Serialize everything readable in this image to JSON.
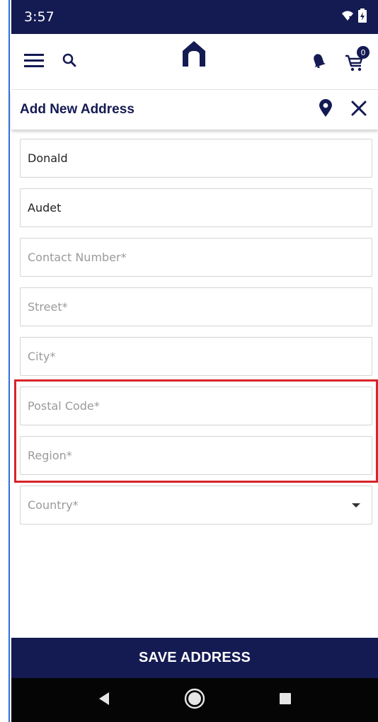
{
  "status_bar": {
    "time": "3:57"
  },
  "top_nav": {
    "cart_count": "0"
  },
  "header": {
    "title": "Add New Address"
  },
  "form": {
    "first_name": {
      "value": "Donald",
      "placeholder": ""
    },
    "last_name": {
      "value": "Audet",
      "placeholder": ""
    },
    "contact_number": {
      "value": "",
      "placeholder": "Contact Number*"
    },
    "street": {
      "value": "",
      "placeholder": "Street*"
    },
    "city": {
      "value": "",
      "placeholder": "City*"
    },
    "postal_code": {
      "value": "",
      "placeholder": "Postal Code*"
    },
    "region": {
      "value": "",
      "placeholder": "Region*"
    },
    "country": {
      "value": "",
      "placeholder": "Country*"
    }
  },
  "footer": {
    "save_label": "SAVE ADDRESS"
  },
  "colors": {
    "brand_navy": "#141a52",
    "highlight_red": "#d8232a"
  },
  "icons": [
    "menu-icon",
    "search-icon",
    "home-logo-icon",
    "bell-icon",
    "cart-icon",
    "location-pin-icon",
    "close-icon",
    "chevron-down-icon",
    "back-icon",
    "home-icon",
    "recents-icon"
  ]
}
